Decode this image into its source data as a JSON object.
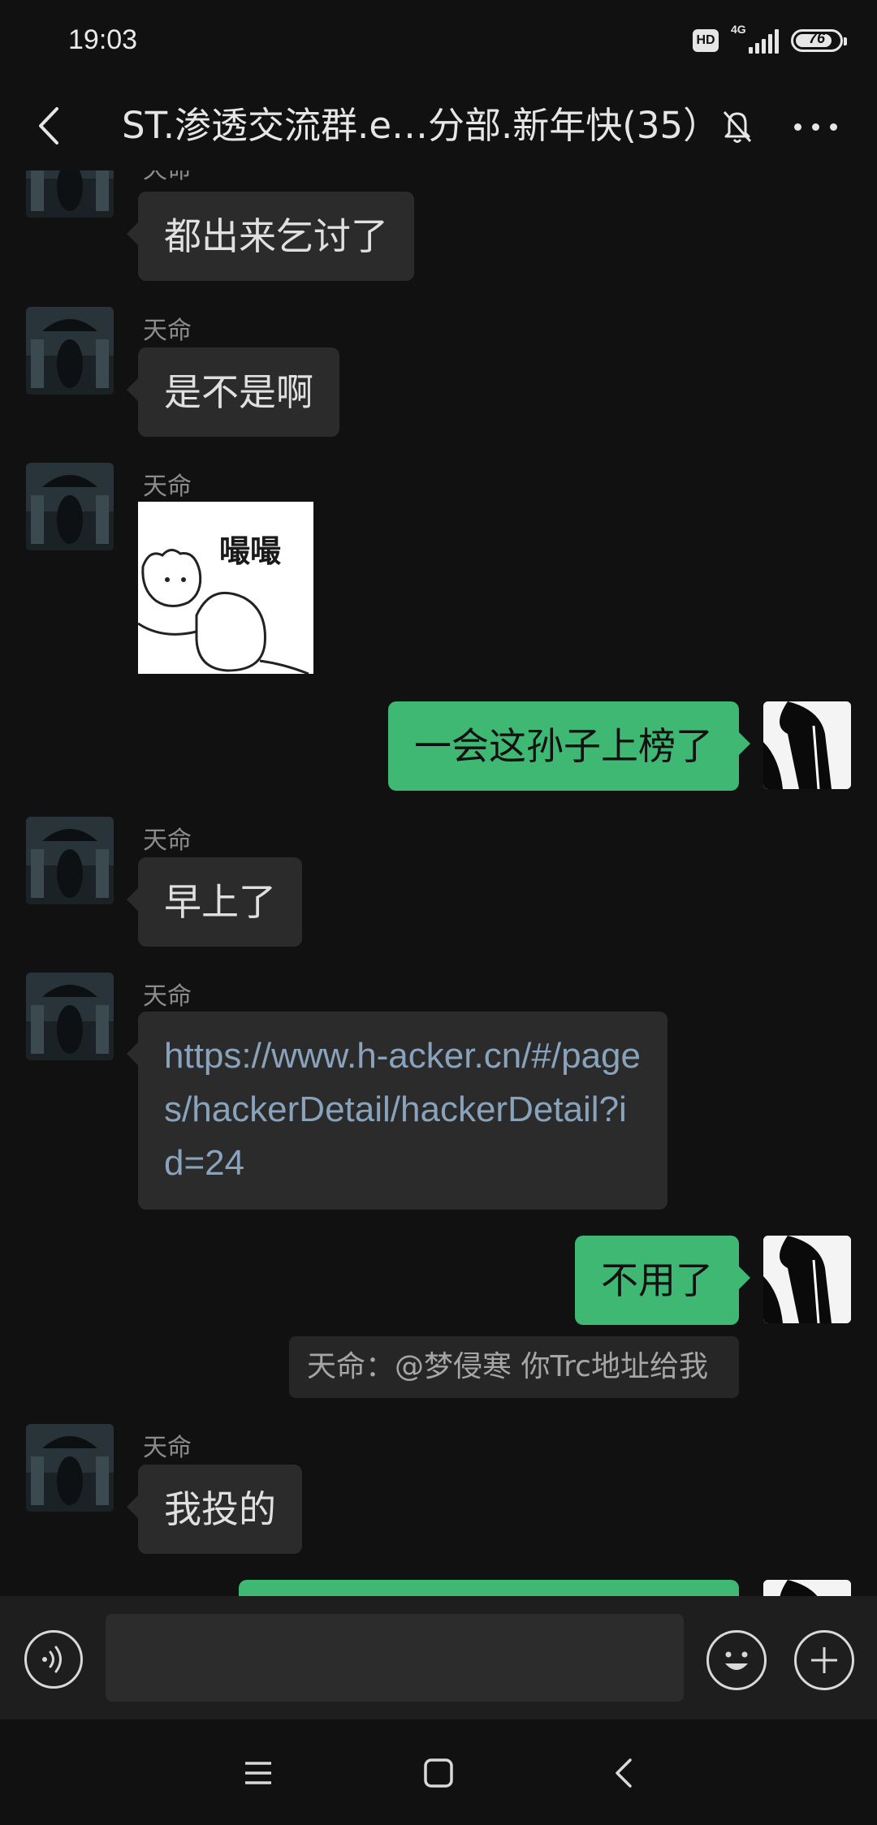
{
  "status_bar": {
    "time": "19:03",
    "hd_label": "HD",
    "network_label": "4G",
    "battery": "76"
  },
  "header": {
    "title": "ST.渗透交流群.e…分部.新年快(35）",
    "back_icon": "chevron-left-icon",
    "mute_icon": "bell-off-icon",
    "more_icon": "more-dots-icon"
  },
  "messages": [
    {
      "sender": "天命",
      "text": "都出来乞讨了"
    },
    {
      "sender": "天命",
      "text": "是不是啊"
    },
    {
      "sender": "天命",
      "sticker_text": "嘬嘬"
    },
    {
      "text": "一会这孙子上榜了"
    },
    {
      "sender": "天命",
      "text": "早上了"
    },
    {
      "sender": "天命",
      "link": "https://www.h-acker.cn/#/pages/hackerDetail/hackerDetail?id=24"
    },
    {
      "text": "不用了"
    },
    {
      "quote": "天命：@梦侵寒 你Trc地址给我"
    },
    {
      "sender": "天命",
      "text": "我投的"
    }
  ],
  "input_bar": {
    "voice_icon": "voice-icon",
    "input_value": "",
    "emoji_icon": "emoji-icon",
    "plus_icon": "plus-icon"
  },
  "nav_bar": {
    "menu_icon": "menu-icon",
    "home_icon": "home-square-icon",
    "back_icon": "back-triangle-icon"
  },
  "colors": {
    "background": "#111111",
    "incoming_bubble": "#2b2b2b",
    "outgoing_bubble": "#3eb872",
    "link": "#8aa3bd"
  }
}
